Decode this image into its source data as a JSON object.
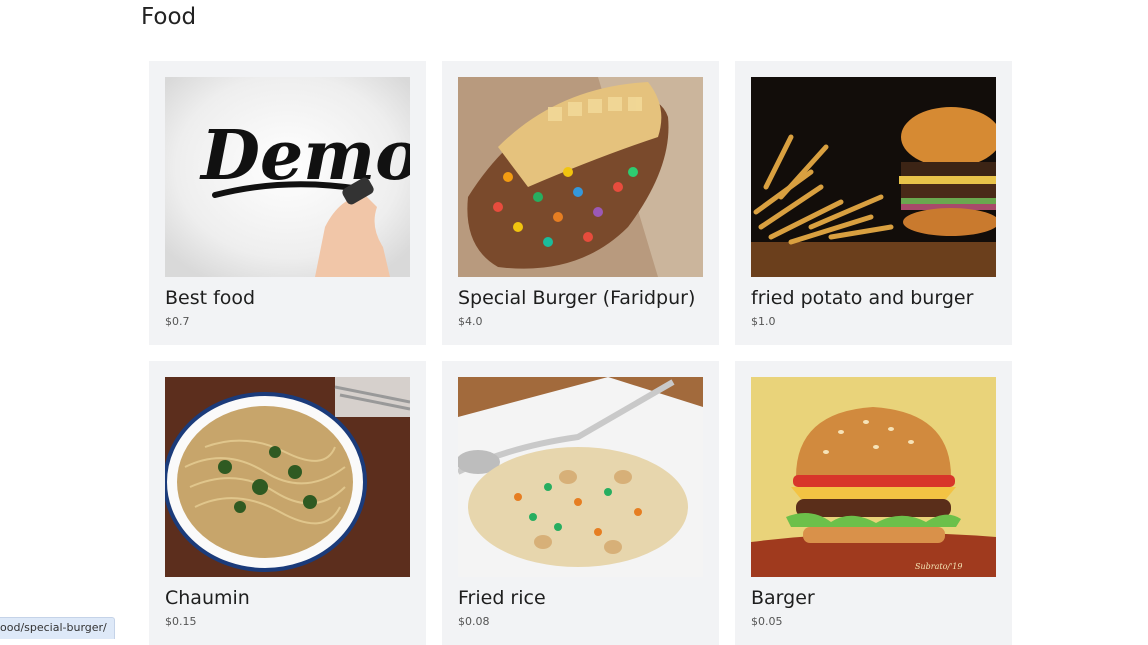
{
  "page": {
    "title": "Food"
  },
  "items": [
    {
      "name": "Best food",
      "price": "$0.7",
      "image_overlay_text": "Demo"
    },
    {
      "name": "Special Burger (Faridpur)",
      "price": "$4.0"
    },
    {
      "name": "fried potato and burger",
      "price": "$1.0"
    },
    {
      "name": "Chaumin",
      "price": "$0.15"
    },
    {
      "name": "Fried rice",
      "price": "$0.08"
    },
    {
      "name": "Barger",
      "price": "$0.05",
      "image_signature": "Subrato/'19"
    }
  ],
  "status_bar": {
    "link": "ood/special-burger/"
  }
}
